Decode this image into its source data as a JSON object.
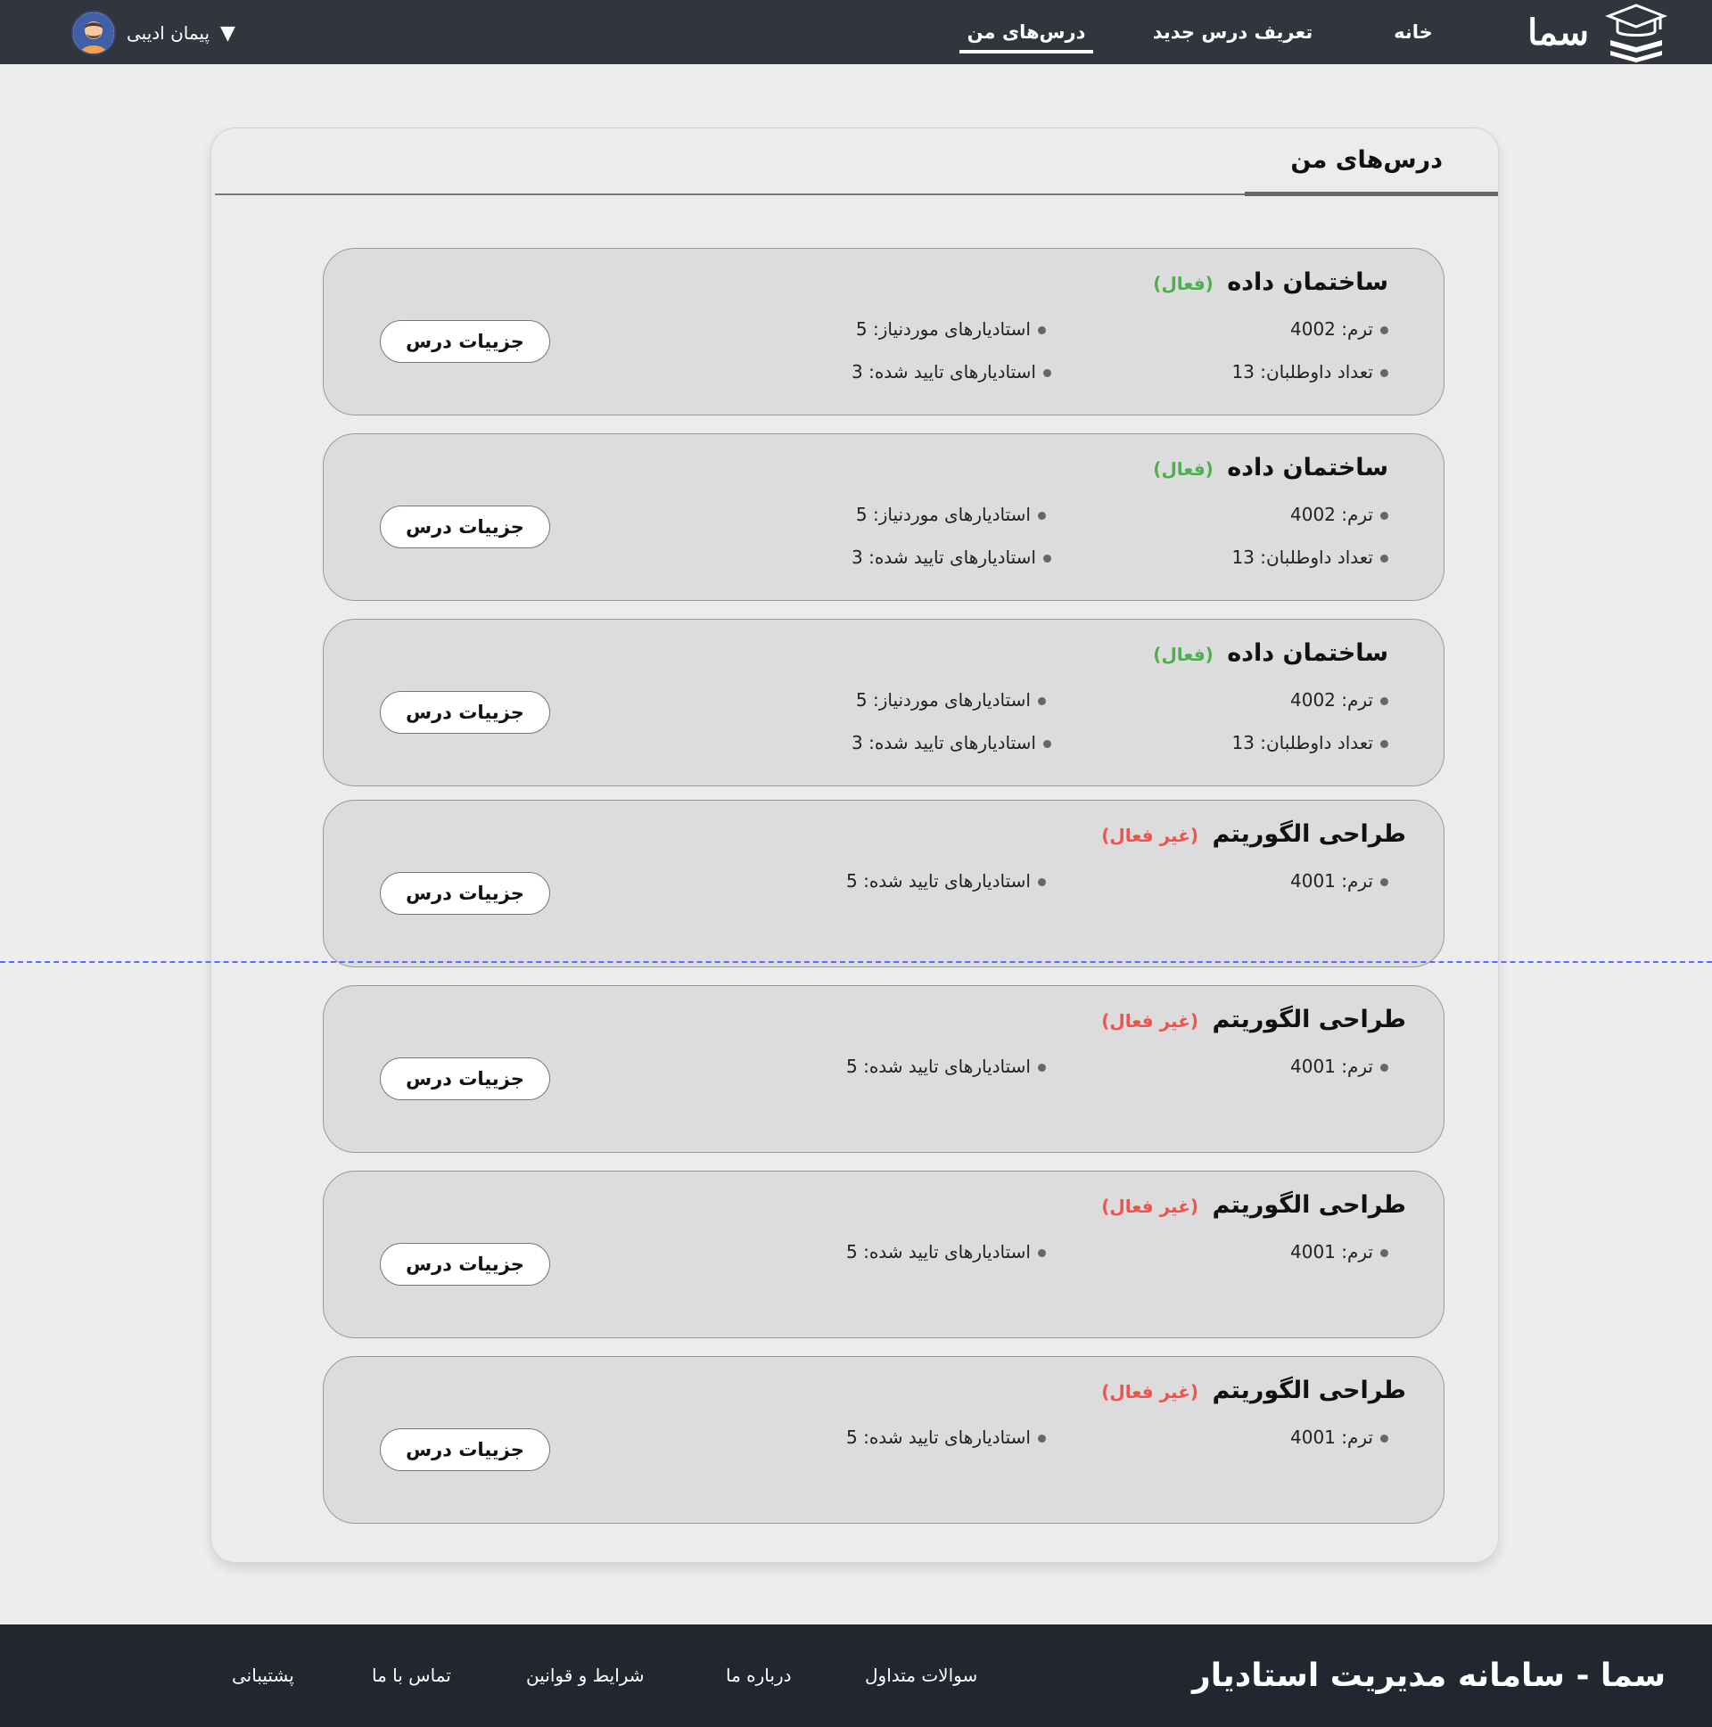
{
  "header": {
    "brand": "سما",
    "nav": [
      {
        "label": "خانه"
      },
      {
        "label": "تعریف درس جدید"
      },
      {
        "label": "درس‌های من",
        "active": true
      }
    ],
    "user": {
      "name": "پیمان ادیبی",
      "caret": "▼"
    }
  },
  "panel": {
    "title": "درس‌های من"
  },
  "courses": [
    {
      "title": "ساختمان داده",
      "status": "(فعال)",
      "status_kind": "active",
      "term": "ترم: 4002",
      "required": "استادیارهای موردنیاز: 5",
      "volunteers": "تعداد داوطلبان: 13",
      "approved": "استادیارهای تایید شده: 3",
      "button": "جزییات درس"
    },
    {
      "title": "ساختمان داده",
      "status": "(فعال)",
      "status_kind": "active",
      "term": "ترم: 4002",
      "required": "استادیارهای موردنیاز: 5",
      "volunteers": "تعداد داوطلبان: 13",
      "approved": "استادیارهای تایید شده: 3",
      "button": "جزییات درس"
    },
    {
      "title": "ساختمان داده",
      "status": "(فعال)",
      "status_kind": "active",
      "term": "ترم: 4002",
      "required": "استادیارهای موردنیاز: 5",
      "volunteers": "تعداد داوطلبان: 13",
      "approved": "استادیارهای تایید شده: 3",
      "button": "جزییات درس"
    },
    {
      "title": "طراحی الگوریتم",
      "status": "(غیر فعال)",
      "status_kind": "inactive",
      "term": "ترم: 4001",
      "approved": "استادیارهای تایید شده: 5",
      "button": "جزییات درس"
    },
    {
      "title": "طراحی الگوریتم",
      "status": "(غیر فعال)",
      "status_kind": "inactive",
      "term": "ترم: 4001",
      "approved": "استادیارهای تایید شده: 5",
      "button": "جزییات درس"
    },
    {
      "title": "طراحی الگوریتم",
      "status": "(غیر فعال)",
      "status_kind": "inactive",
      "term": "ترم: 4001",
      "approved": "استادیارهای تایید شده: 5",
      "button": "جزییات درس"
    },
    {
      "title": "طراحی الگوریتم",
      "status": "(غیر فعال)",
      "status_kind": "inactive",
      "term": "ترم: 4001",
      "approved": "استادیارهای تایید شده: 5",
      "button": "جزییات درس"
    }
  ],
  "footer": {
    "title": "سما - سامانه مدیریت استادیار",
    "links": [
      {
        "label": "سوالات متداول"
      },
      {
        "label": "درباره ما"
      },
      {
        "label": "شرایط و قوانین"
      },
      {
        "label": "تماس با ما"
      },
      {
        "label": "پشتیبانی"
      }
    ]
  },
  "colors": {
    "header_bg": "#30353e",
    "footer_bg": "#212630",
    "status_active": "#4caf50",
    "status_inactive": "#ef5350"
  },
  "icons": {
    "logo": "graduation-cap-books-icon",
    "avatar": "user-avatar-icon",
    "caret": "caret-down-icon",
    "bullet": "bullet-dot-icon"
  }
}
